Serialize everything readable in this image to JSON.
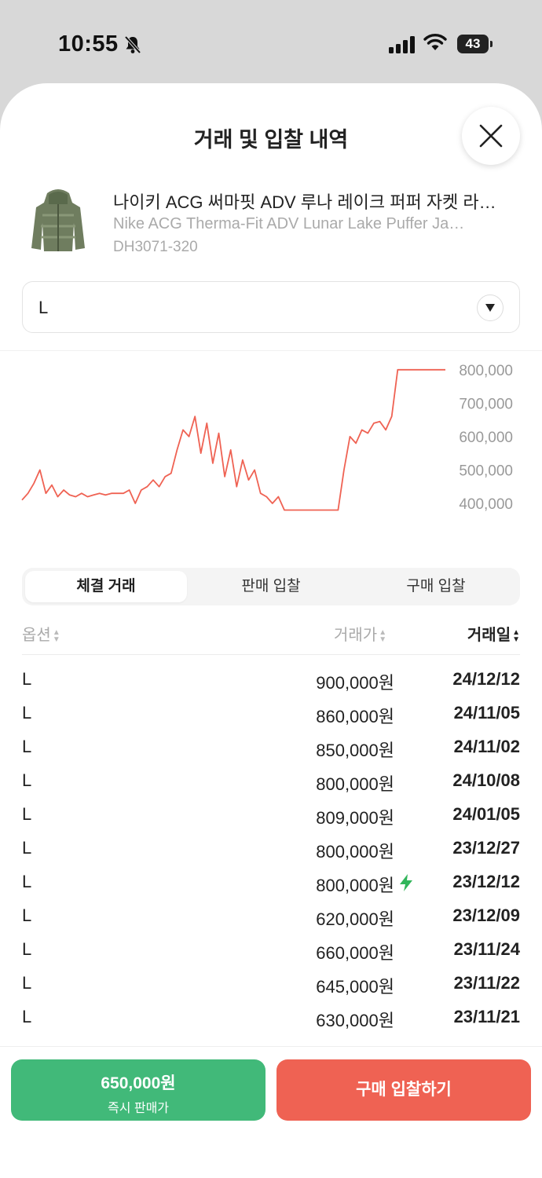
{
  "status": {
    "time": "10:55",
    "battery": "43"
  },
  "sheet": {
    "title": "거래 및 입찰 내역"
  },
  "product": {
    "name": "나이키 ACG 써마핏 ADV 루나 레이크 퍼퍼 자켓 라…",
    "name_en": "Nike ACG Therma-Fit ADV Lunar Lake Puffer Ja…",
    "code": "DH3071-320"
  },
  "size_select": {
    "value": "L"
  },
  "chart_data": {
    "type": "line",
    "title": "",
    "xlabel": "",
    "ylabel": "",
    "yticks": [
      "800,000",
      "700,000",
      "600,000",
      "500,000",
      "400,000"
    ],
    "ylim": [
      360000,
      830000
    ],
    "color": "#ef6253",
    "values": [
      410000,
      430000,
      460000,
      500000,
      430000,
      455000,
      420000,
      440000,
      425000,
      420000,
      430000,
      420000,
      425000,
      430000,
      425000,
      430000,
      430000,
      430000,
      440000,
      400000,
      440000,
      450000,
      470000,
      450000,
      480000,
      490000,
      560000,
      620000,
      600000,
      660000,
      550000,
      640000,
      520000,
      610000,
      480000,
      560000,
      450000,
      530000,
      470000,
      500000,
      430000,
      420000,
      400000,
      420000,
      380000,
      380000,
      380000,
      380000,
      380000,
      380000,
      380000,
      380000,
      380000,
      380000,
      500000,
      600000,
      580000,
      620000,
      610000,
      640000,
      645000,
      620000,
      660000,
      800000,
      800000,
      800000,
      800000,
      800000,
      800000,
      800000,
      800000,
      800000
    ]
  },
  "tabs": [
    "체결 거래",
    "판매 입찰",
    "구매 입찰"
  ],
  "table": {
    "headers": {
      "option": "옵션",
      "price": "거래가",
      "date": "거래일"
    },
    "rows": [
      {
        "option": "L",
        "price": "900,000원",
        "date": "24/12/12",
        "express": false
      },
      {
        "option": "L",
        "price": "860,000원",
        "date": "24/11/05",
        "express": false
      },
      {
        "option": "L",
        "price": "850,000원",
        "date": "24/11/02",
        "express": false
      },
      {
        "option": "L",
        "price": "800,000원",
        "date": "24/10/08",
        "express": false
      },
      {
        "option": "L",
        "price": "809,000원",
        "date": "24/01/05",
        "express": false
      },
      {
        "option": "L",
        "price": "800,000원",
        "date": "23/12/27",
        "express": false
      },
      {
        "option": "L",
        "price": "800,000원",
        "date": "23/12/12",
        "express": true
      },
      {
        "option": "L",
        "price": "620,000원",
        "date": "23/12/09",
        "express": false
      },
      {
        "option": "L",
        "price": "660,000원",
        "date": "23/11/24",
        "express": false
      },
      {
        "option": "L",
        "price": "645,000원",
        "date": "23/11/22",
        "express": false
      },
      {
        "option": "L",
        "price": "630,000원",
        "date": "23/11/21",
        "express": false
      }
    ]
  },
  "footer": {
    "sell_price": "650,000원",
    "sell_label": "즉시 판매가",
    "buy_label": "구매 입찰하기"
  }
}
